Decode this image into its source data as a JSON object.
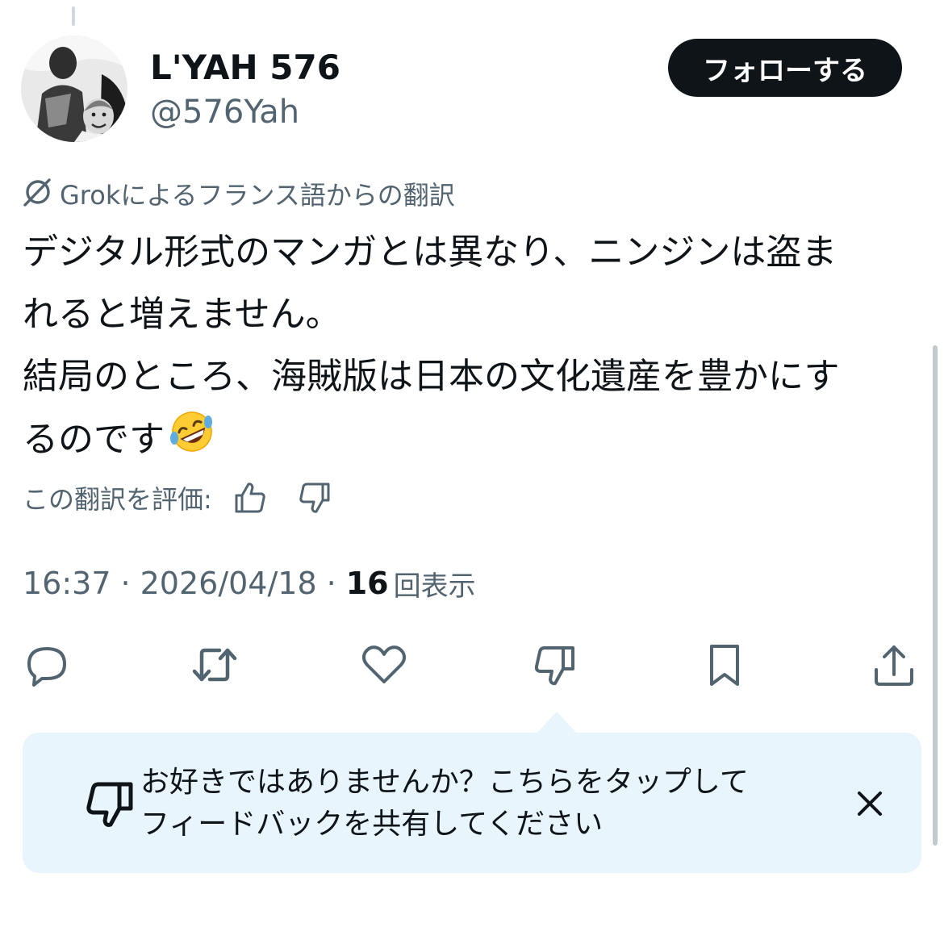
{
  "author": {
    "display_name": "L'YAH 576",
    "handle": "@576Yah",
    "follow_label": "フォローする"
  },
  "translation": {
    "source_label": "Grokによるフランス語からの翻訳",
    "icon": "grok-icon"
  },
  "tweet": {
    "lines": [
      "デジタル形式のマンガとは異なり、ニンジンは盗ま",
      "れると増えません。",
      "結局のところ、海賊版は日本の文化遺産を豊かにす",
      "るのです"
    ],
    "emoji": "rolling-on-the-floor-laughing-emoji"
  },
  "rating": {
    "label": "この翻訳を評価:",
    "icons": [
      "thumbs-up-icon",
      "thumbs-down-icon"
    ]
  },
  "meta": {
    "time": "16:37",
    "separator": "·",
    "date": "2026/04/18",
    "views_count": "16",
    "views_label": "回表示"
  },
  "actions": [
    "reply-icon",
    "retweet-icon",
    "like-icon",
    "dislike-icon",
    "bookmark-icon",
    "share-icon"
  ],
  "feedback_tooltip": {
    "line1": "お好きではありませんか？こちらをタップして",
    "line2": "フィードバックを共有してください",
    "icon": "thumbs-down-icon",
    "close_icon": "close-icon"
  },
  "colors": {
    "text_primary": "#0f1419",
    "text_secondary": "#536471",
    "follow_bg": "#0f1419",
    "tooltip_bg": "#e8f5fd"
  }
}
